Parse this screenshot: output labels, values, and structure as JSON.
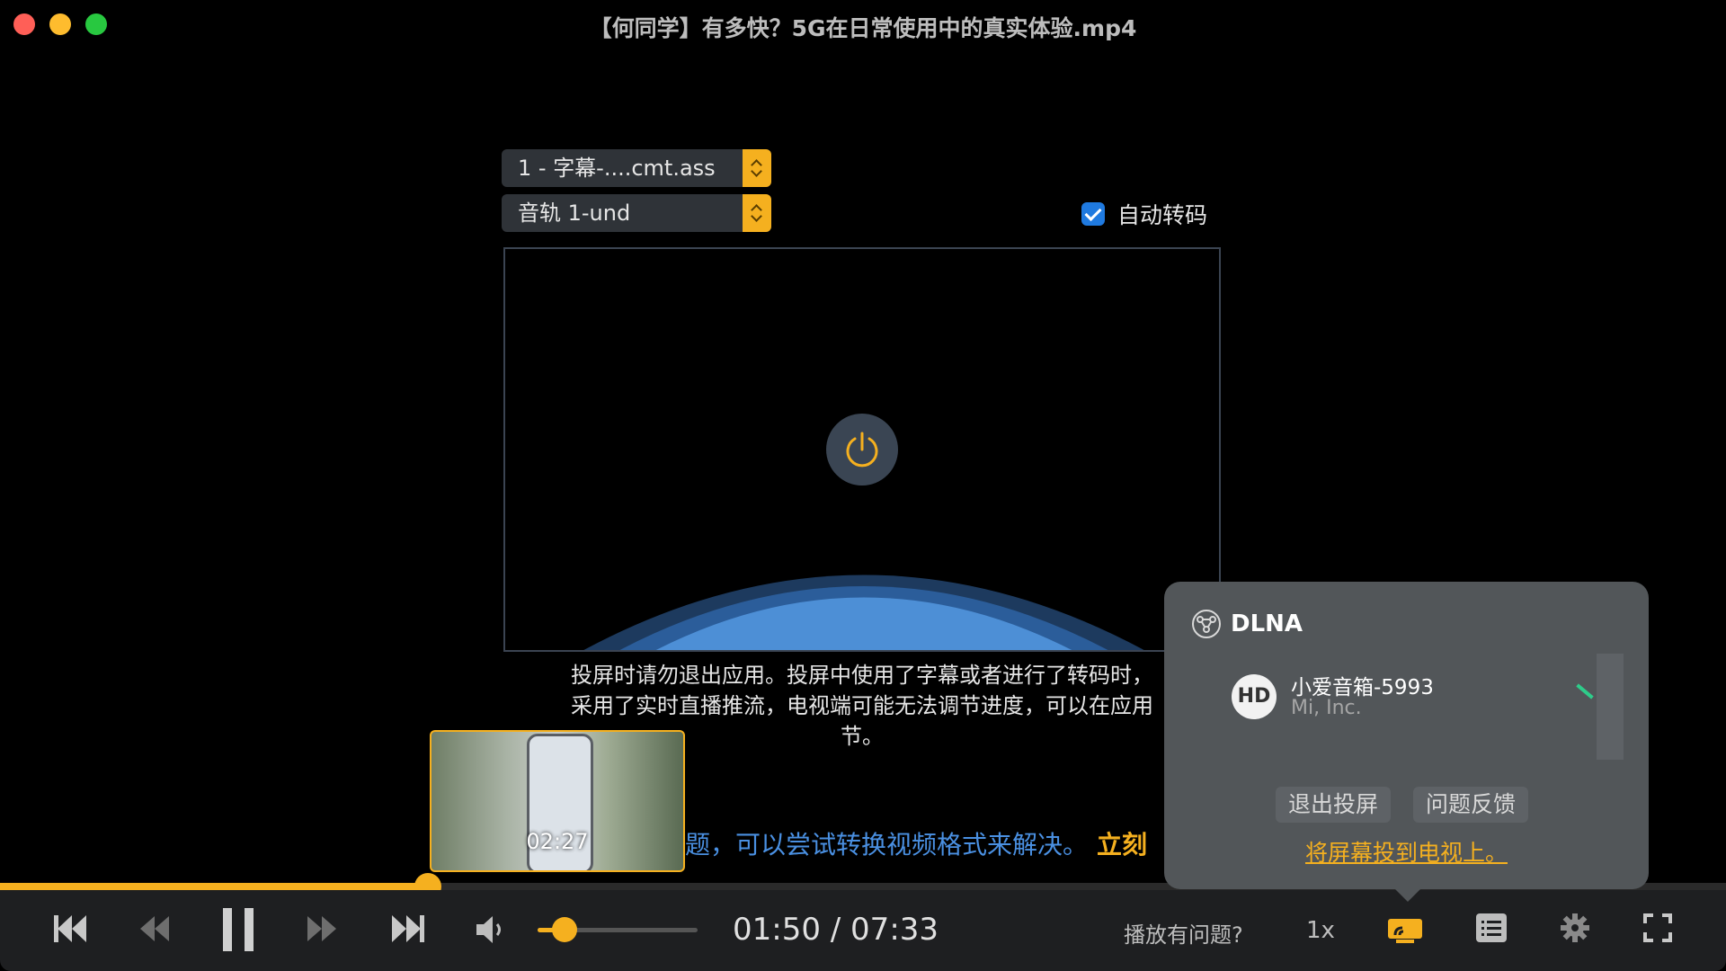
{
  "window": {
    "title": "【何同学】有多快？5G在日常使用中的真实体验.mp4"
  },
  "cast_panel": {
    "subtitle_select_value": "1 - 字幕-....cmt.ass",
    "audio_select_value": "音轨 1-und",
    "auto_transcode_label": "自动转码",
    "auto_transcode_checked": true,
    "power_icon": "power-icon",
    "info_lines": [
      "投屏时请勿退出应用。投屏中使用了字幕或者进行了转码时，",
      "采用了实时直播推流，电视端可能无法调节进度，可以在应用",
      "节。"
    ]
  },
  "hover_preview": {
    "time": "02:27"
  },
  "tip": {
    "text": "题，可以尝试转换视频格式来解决。",
    "link": "立刻"
  },
  "playback": {
    "progress_fraction": 0.248,
    "current_time": "01:50",
    "total_time": "07:33",
    "time_display": "01:50 / 07:33",
    "volume_fraction": 0.17,
    "trouble_label": "播放有问题?",
    "speed_label": "1x",
    "accent_color": "#f5b01f"
  },
  "dlna": {
    "title": "DLNA",
    "device_badge": "HD",
    "device_name": "小爱音箱-5993",
    "device_maker": "Mi, Inc.",
    "exit_button": "退出投屏",
    "feedback_button": "问题反馈",
    "mirror_link": "将屏幕投到电视上。"
  }
}
